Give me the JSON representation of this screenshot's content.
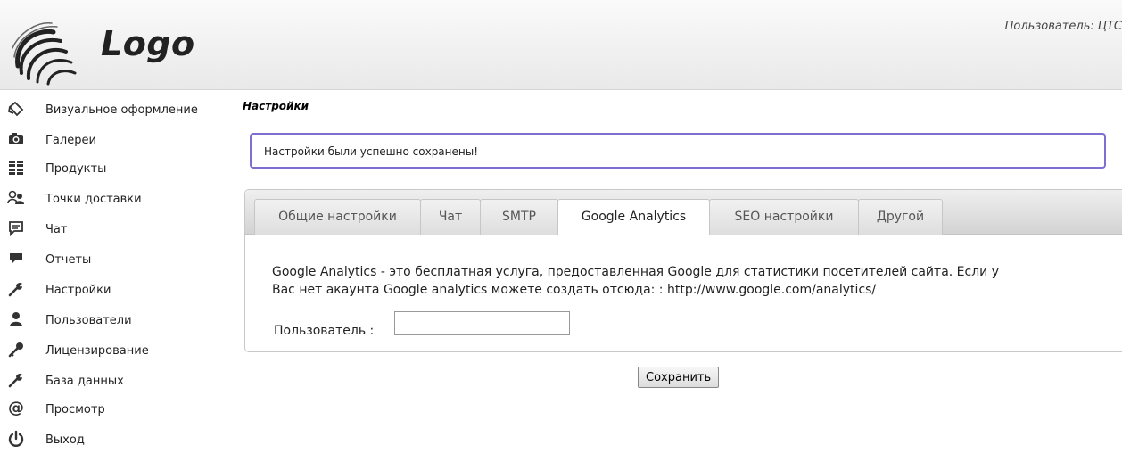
{
  "header": {
    "logo_text": "Logo",
    "user_label": "Пользователь: ЦТС"
  },
  "sidebar": {
    "items": [
      {
        "label": "Визуальное оформление",
        "icon": "palette-icon"
      },
      {
        "label": "Галереи",
        "icon": "camera-icon"
      },
      {
        "label": "Продукты",
        "icon": "boxes-icon"
      },
      {
        "label": "Точки доставки",
        "icon": "delivery-users-icon"
      },
      {
        "label": "Чат",
        "icon": "chat-bubble-icon"
      },
      {
        "label": "Отчеты",
        "icon": "comment-icon"
      },
      {
        "label": "Настройки",
        "icon": "wrench-icon"
      },
      {
        "label": "Пользователи",
        "icon": "user-icon"
      },
      {
        "label": "Лицензирование",
        "icon": "key-icon"
      },
      {
        "label": "База данных",
        "icon": "wrench-icon"
      },
      {
        "label": "Просмотр",
        "icon": "at-icon"
      },
      {
        "label": "Выход",
        "icon": "power-icon"
      }
    ]
  },
  "main": {
    "title": "Настройки",
    "alert": "Настройки были успешно сохранены!",
    "tabs": [
      {
        "label": "Общие настройки",
        "active": false
      },
      {
        "label": "Чат",
        "active": false
      },
      {
        "label": "SMTP",
        "active": false
      },
      {
        "label": "Google Analytics",
        "active": true
      },
      {
        "label": "SEO настройки",
        "active": false
      },
      {
        "label": "Другой",
        "active": false
      }
    ],
    "description_line1": "Google Analytics - это бесплатная услуга, предоставленная Google для статистики посетителей сайта. Если у",
    "description_line2": "Вас нет акаунта Google analytics можете создать отсюда: : http://www.google.com/analytics/",
    "field_label": "Пользователь :",
    "field_value": "",
    "save_label": "Сохранить"
  },
  "colors": {
    "alert_border": "#7d6fd0",
    "header_bg": "#f0f0f0"
  }
}
